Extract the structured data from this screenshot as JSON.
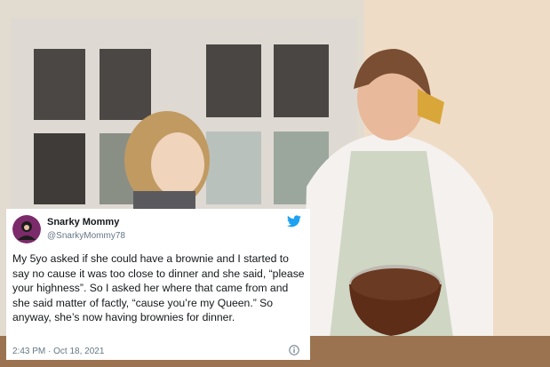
{
  "tweet": {
    "display_name": "Snarky Mommy",
    "handle": "@SnarkyMommy78",
    "text": "My 5yo asked if she could have a brownie and I started to say no cause it was too close to dinner and she said, “please your highness”. So I asked her where that came from and she said matter of factly, “cause you’re my Queen.” So anyway, she’s now having brownies for dinner.",
    "timestamp": "2:43 PM · Oct 18, 2021",
    "icons": [
      "twitter-bird-icon",
      "info-icon"
    ]
  },
  "colors": {
    "twitter_blue": "#1da1f2",
    "text_primary": "#14171a",
    "text_secondary": "#657786"
  }
}
